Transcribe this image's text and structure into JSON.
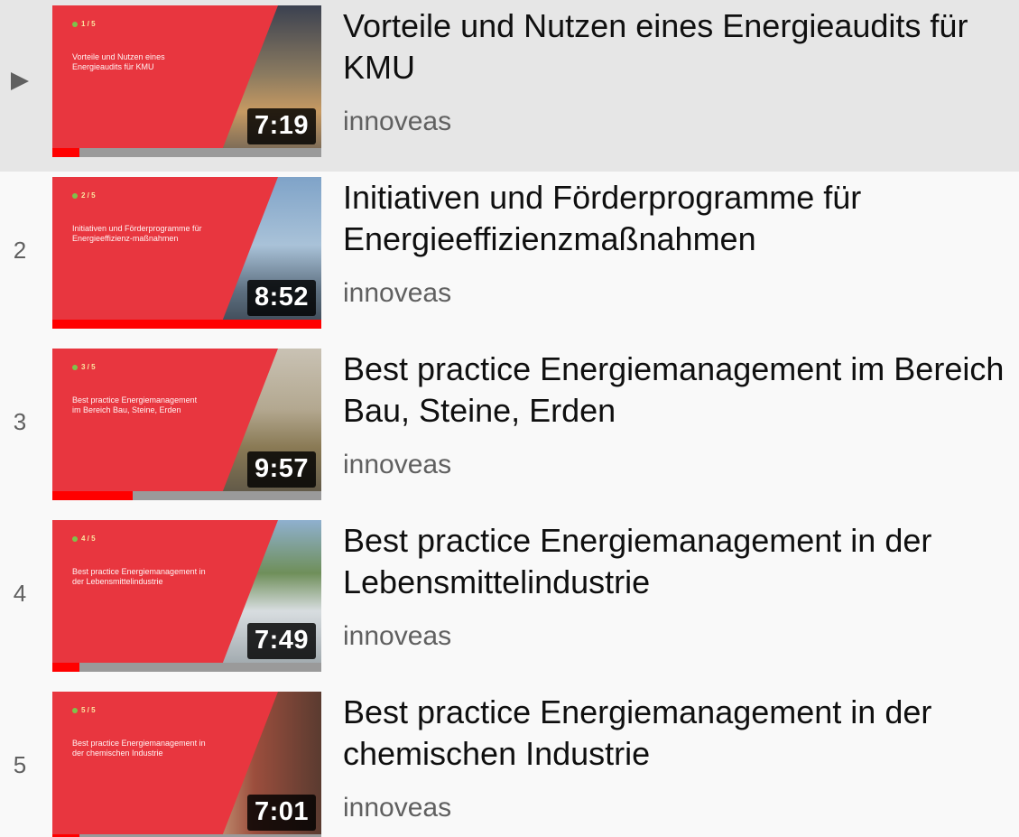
{
  "playlist": {
    "items": [
      {
        "index": "",
        "active": true,
        "title": "Vorteile und Nutzen eines Energieaudits für KMU",
        "channel": "innoveas",
        "duration": "7:19",
        "watched_fraction": 0.1,
        "thumb_tag": "1 / 5",
        "thumb_text": "Vorteile und Nutzen eines Energieaudits für KMU"
      },
      {
        "index": "2",
        "active": false,
        "title": "Initiativen und Förderprogramme für Energieeffizienzmaßnahmen",
        "channel": "innoveas",
        "duration": "8:52",
        "watched_fraction": 1.0,
        "thumb_tag": "2 / 5",
        "thumb_text": "Initiativen und Förderprogramme für Energieeffizienz-maßnahmen"
      },
      {
        "index": "3",
        "active": false,
        "title": "Best practice Energiemanagement im Bereich Bau, Steine, Erden",
        "channel": "innoveas",
        "duration": "9:57",
        "watched_fraction": 0.3,
        "thumb_tag": "3 / 5",
        "thumb_text": "Best practice Energiemanagement im Bereich Bau, Steine, Erden"
      },
      {
        "index": "4",
        "active": false,
        "title": "Best practice Energiemanagement in der Lebensmittelindustrie",
        "channel": "innoveas",
        "duration": "7:49",
        "watched_fraction": 0.1,
        "thumb_tag": "4 / 5",
        "thumb_text": "Best practice Energiemanagement in der Lebensmittelindustrie"
      },
      {
        "index": "5",
        "active": false,
        "title": "Best practice Energiemanagement in der chemischen Industrie",
        "channel": "innoveas",
        "duration": "7:01",
        "watched_fraction": 0.1,
        "thumb_tag": "5 / 5",
        "thumb_text": "Best practice Energiemanagement in der chemischen Industrie"
      }
    ]
  },
  "colors": {
    "thumb_red": "#e8363f",
    "progress_red": "#ff0000",
    "active_row": "#e6e6e6",
    "background": "#f9f9f9"
  }
}
